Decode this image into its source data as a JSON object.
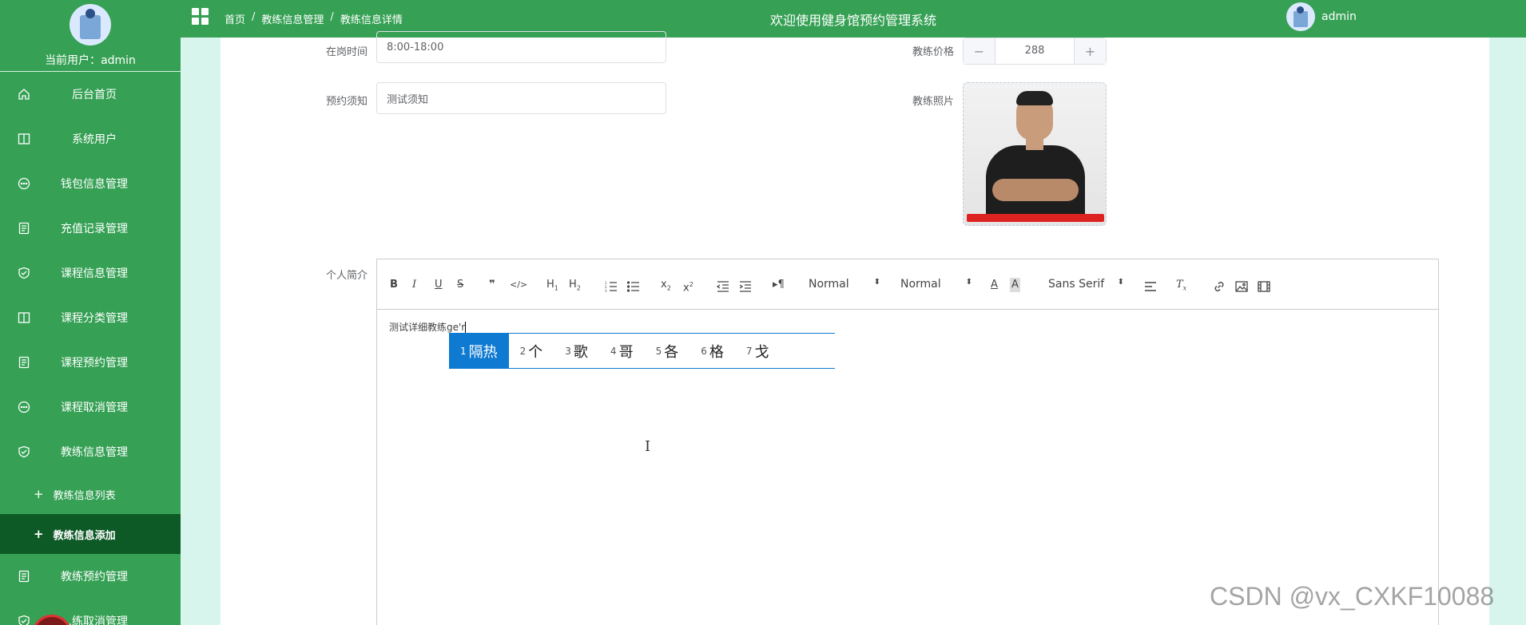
{
  "sidebar": {
    "current_user_label": "当前用户：",
    "current_user": "admin",
    "menu": [
      {
        "label": "后台首页",
        "icon": "home-icon"
      },
      {
        "label": "系统用户",
        "icon": "columns-icon"
      },
      {
        "label": "钱包信息管理",
        "icon": "chat-icon"
      },
      {
        "label": "充值记录管理",
        "icon": "document-icon"
      },
      {
        "label": "课程信息管理",
        "icon": "shield-check-icon"
      },
      {
        "label": "课程分类管理",
        "icon": "columns-icon"
      },
      {
        "label": "课程预约管理",
        "icon": "document-icon"
      },
      {
        "label": "课程取消管理",
        "icon": "chat-icon"
      },
      {
        "label": "教练信息管理",
        "icon": "shield-check-icon"
      }
    ],
    "submenu": [
      {
        "label": "教练信息列表",
        "active": false
      },
      {
        "label": "教练信息添加",
        "active": true
      }
    ],
    "menu_after": [
      {
        "label": "教练预约管理",
        "icon": "document-icon"
      },
      {
        "label": "…练取消管理",
        "icon": "shield-check-icon"
      }
    ]
  },
  "header": {
    "breadcrumb": [
      "首页",
      "教练信息管理",
      "教练信息详情"
    ],
    "breadcrumb_sep": "/",
    "title": "欢迎使用健身馆预约管理系统",
    "username": "admin"
  },
  "form": {
    "work_time_label": "在岗时间",
    "work_time_value": "8:00-18:00",
    "notice_label": "预约须知",
    "notice_value": "测试须知",
    "price_label": "教练价格",
    "price_value": "288",
    "photo_label": "教练照片",
    "bio_label": "个人简介"
  },
  "editor": {
    "content": "测试详细教练ge'r",
    "header_picker": "Normal",
    "size_picker": "Normal",
    "font_picker": "Sans Serif"
  },
  "ime": {
    "candidates": [
      {
        "n": "1",
        "text": "隔热"
      },
      {
        "n": "2",
        "text": "个"
      },
      {
        "n": "3",
        "text": "歌"
      },
      {
        "n": "4",
        "text": "哥"
      },
      {
        "n": "5",
        "text": "各"
      },
      {
        "n": "6",
        "text": "格"
      },
      {
        "n": "7",
        "text": "戈"
      }
    ]
  },
  "watermark": "CSDN @vx_CXKF10088",
  "colors": {
    "primary_green": "#36a155",
    "active_submenu": "#0e5a27",
    "background_mint": "#d7f5ec",
    "ime_blue": "#0f7ad2"
  }
}
